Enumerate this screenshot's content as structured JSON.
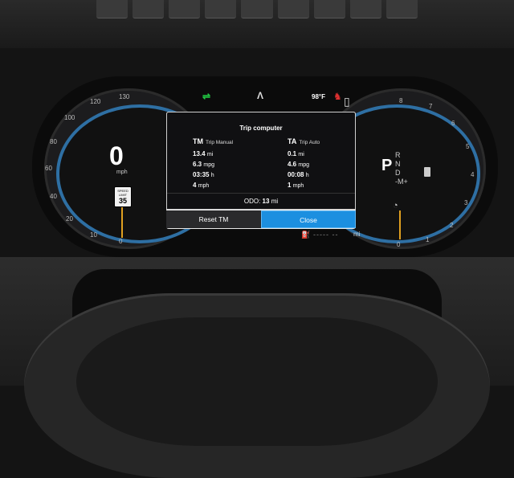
{
  "colors": {
    "accent_blue": "#1c8fe0",
    "gauge_ring": "#2e6fa3",
    "warning_amber": "#e8a020",
    "cruise_green": "#22cc44",
    "seatbelt_red": "#e03030"
  },
  "top_bar": {
    "temperature": "98°F",
    "cruise_icon": "adaptive-cruise-icon",
    "lane_icon": "lane-assist-icon",
    "seatbelt_icon": "seatbelt-warning-icon",
    "door_icon": "door-open-icon"
  },
  "speedometer": {
    "ticks": [
      "0",
      "10",
      "20",
      "40",
      "60",
      "80",
      "100",
      "120",
      "130"
    ],
    "speed": "0",
    "unit": "mph",
    "limit_label": "SPEED LIMIT",
    "limit_value": "35"
  },
  "tachometer": {
    "ticks": [
      "0",
      "1",
      "2",
      "3",
      "4",
      "5",
      "6",
      "7",
      "8"
    ],
    "gear_selected": "P",
    "gears": [
      "R",
      "N",
      "D",
      "-M+"
    ]
  },
  "trip_computer": {
    "title": "Trip computer",
    "manual": {
      "abbr": "TM",
      "name": "Trip Manual",
      "distance": "13.4",
      "distance_unit": "mi",
      "economy": "6.3",
      "economy_unit": "mpg",
      "time": "03:35",
      "time_unit": "h",
      "avg_speed": "4",
      "avg_speed_unit": "mph"
    },
    "auto": {
      "abbr": "TA",
      "name": "Trip Auto",
      "distance": "0.1",
      "distance_unit": "mi",
      "economy": "4.6",
      "economy_unit": "mpg",
      "time": "00:08",
      "time_unit": "h",
      "avg_speed": "1",
      "avg_speed_unit": "mph"
    },
    "odo_label": "ODO:",
    "odo_value": "13",
    "odo_unit": "mi",
    "reset_label": "Reset TM",
    "close_label": "Close"
  },
  "fuel": {
    "icon": "fuel-pump-icon",
    "range_dashes": "----- --",
    "range_unit": "mi"
  }
}
